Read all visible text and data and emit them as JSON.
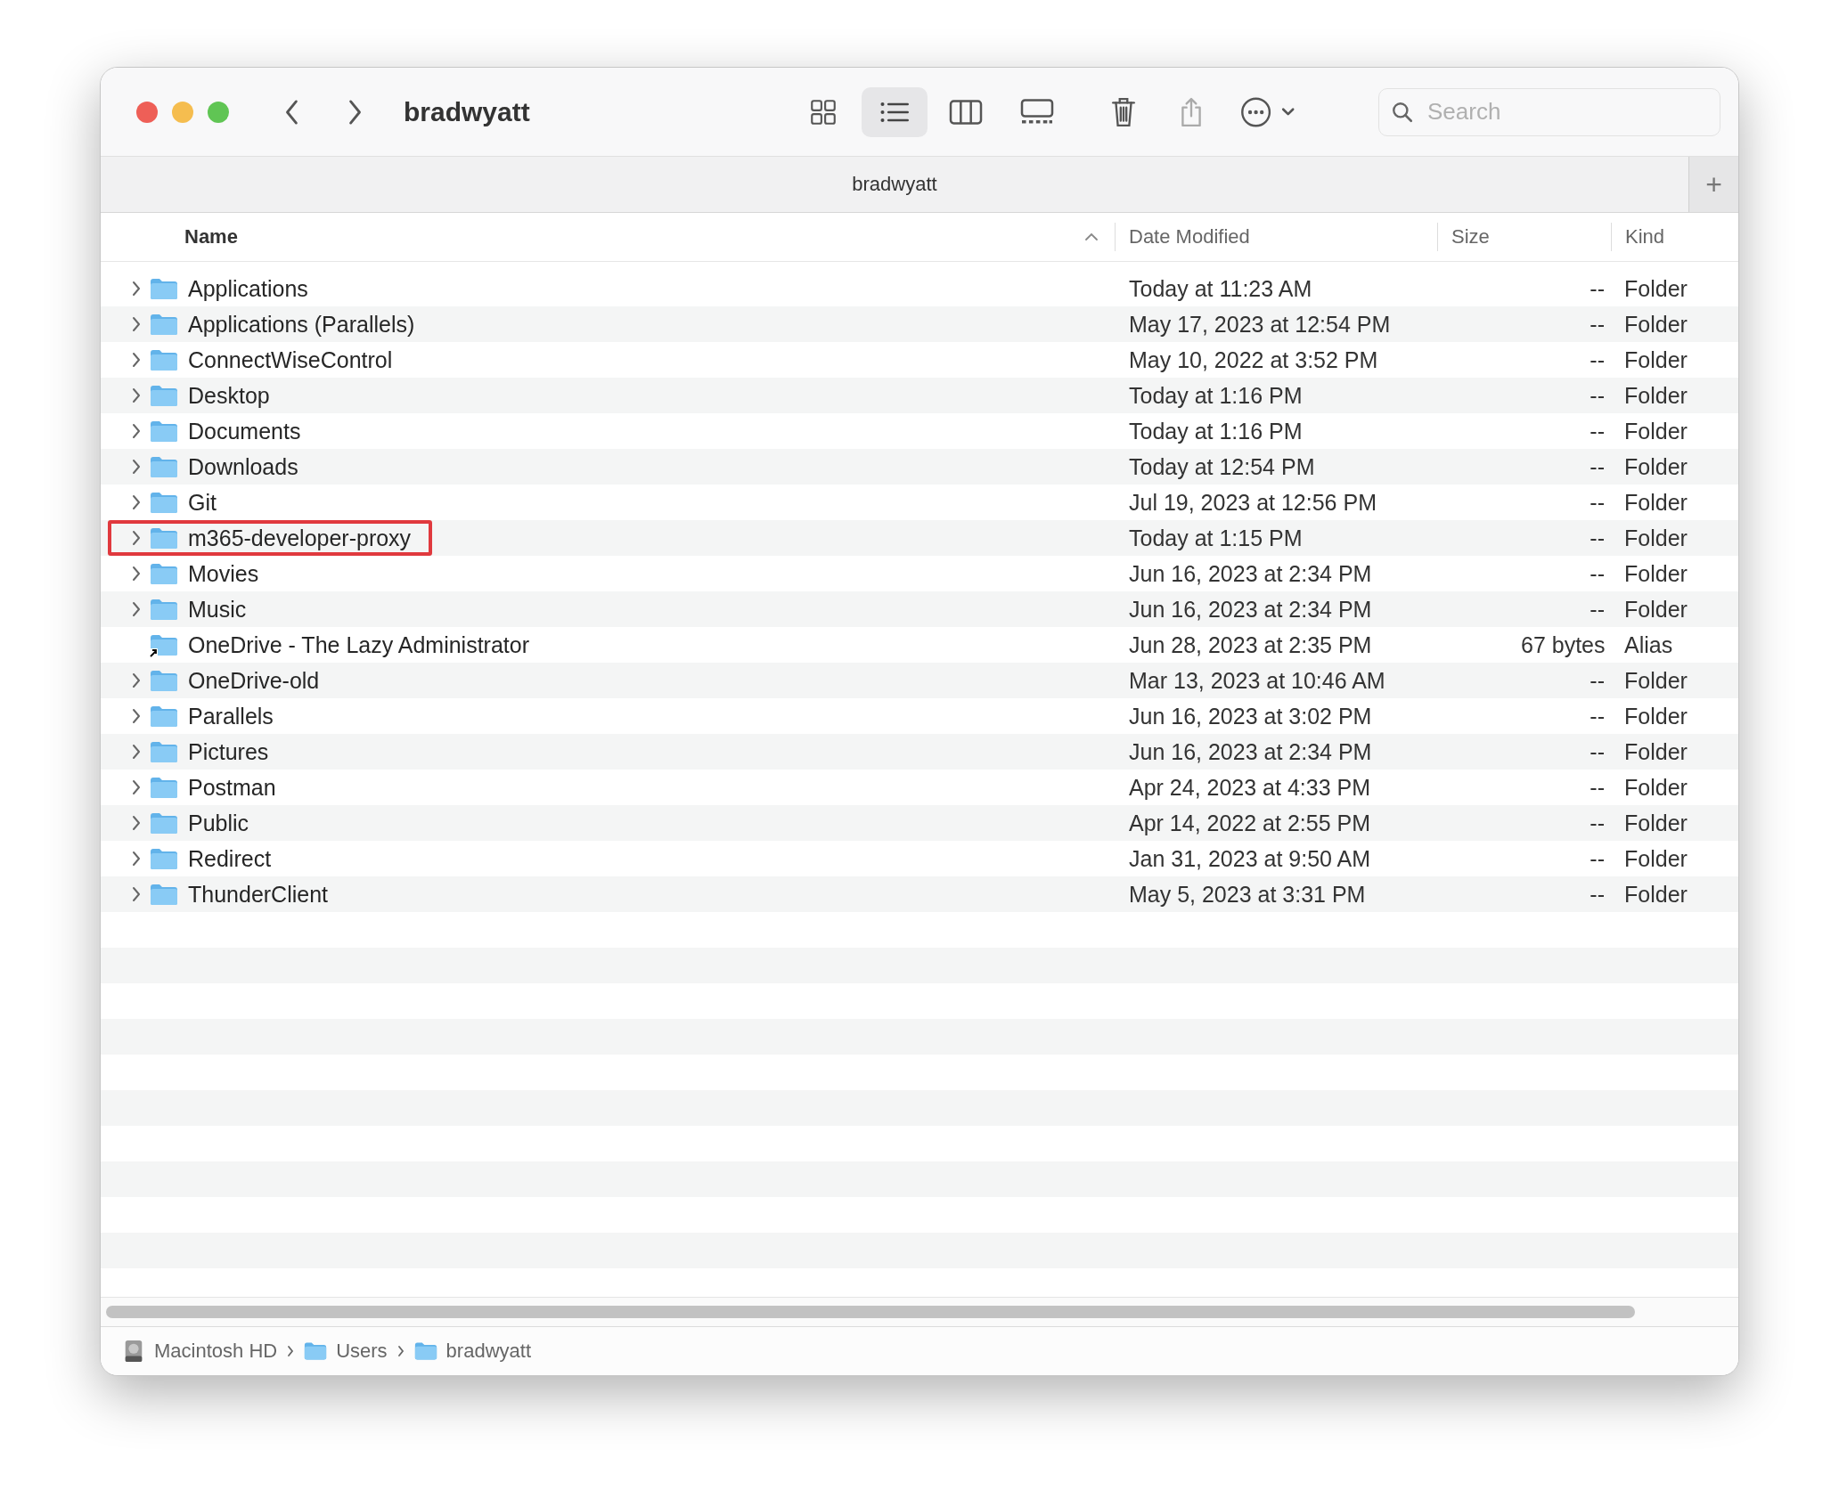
{
  "window": {
    "title": "bradwyatt"
  },
  "toolbar": {
    "view_buttons": [
      {
        "selected": false
      },
      {
        "selected": true
      },
      {
        "selected": false
      },
      {
        "selected": false
      }
    ],
    "search": {
      "placeholder": "Search"
    }
  },
  "tab_bar": {
    "tab": "bradwyatt",
    "new_tab_button": "+"
  },
  "table": {
    "columns": [
      "Name",
      "Date Modified",
      "Size",
      "Kind"
    ],
    "rows": [
      {
        "name": "Applications",
        "date": "Today at 11:23 AM",
        "size": "--",
        "kind_text": "Folder",
        "kind": "folder",
        "highlighted": false
      },
      {
        "name": "Applications (Parallels)",
        "date": "May 17, 2023 at 12:54 PM",
        "size": "--",
        "kind_text": "Folder",
        "kind": "folder",
        "highlighted": false
      },
      {
        "name": "ConnectWiseControl",
        "date": "May 10, 2022 at 3:52 PM",
        "size": "--",
        "kind_text": "Folder",
        "kind": "folder",
        "highlighted": false
      },
      {
        "name": "Desktop",
        "date": "Today at 1:16 PM",
        "size": "--",
        "kind_text": "Folder",
        "kind": "folder",
        "highlighted": false
      },
      {
        "name": "Documents",
        "date": "Today at 1:16 PM",
        "size": "--",
        "kind_text": "Folder",
        "kind": "folder",
        "highlighted": false
      },
      {
        "name": "Downloads",
        "date": "Today at 12:54 PM",
        "size": "--",
        "kind_text": "Folder",
        "kind": "folder",
        "highlighted": false
      },
      {
        "name": "Git",
        "date": "Jul 19, 2023 at 12:56 PM",
        "size": "--",
        "kind_text": "Folder",
        "kind": "folder",
        "highlighted": false
      },
      {
        "name": "m365-developer-proxy",
        "date": "Today at 1:15 PM",
        "size": "--",
        "kind_text": "Folder",
        "kind": "folder",
        "highlighted": true
      },
      {
        "name": "Movies",
        "date": "Jun 16, 2023 at 2:34 PM",
        "size": "--",
        "kind_text": "Folder",
        "kind": "folder",
        "highlighted": false
      },
      {
        "name": "Music",
        "date": "Jun 16, 2023 at 2:34 PM",
        "size": "--",
        "kind_text": "Folder",
        "kind": "folder",
        "highlighted": false
      },
      {
        "name": "OneDrive - The Lazy Administrator",
        "date": "Jun 28, 2023 at 2:35 PM",
        "size": "67 bytes",
        "kind_text": "Alias",
        "kind": "alias",
        "highlighted": false
      },
      {
        "name": "OneDrive-old",
        "date": "Mar 13, 2023 at 10:46 AM",
        "size": "--",
        "kind_text": "Folder",
        "kind": "folder",
        "highlighted": false
      },
      {
        "name": "Parallels",
        "date": "Jun 16, 2023 at 3:02 PM",
        "size": "--",
        "kind_text": "Folder",
        "kind": "folder",
        "highlighted": false
      },
      {
        "name": "Pictures",
        "date": "Jun 16, 2023 at 2:34 PM",
        "size": "--",
        "kind_text": "Folder",
        "kind": "folder",
        "highlighted": false
      },
      {
        "name": "Postman",
        "date": "Apr 24, 2023 at 4:33 PM",
        "size": "--",
        "kind_text": "Folder",
        "kind": "folder",
        "highlighted": false
      },
      {
        "name": "Public",
        "date": "Apr 14, 2022 at 2:55 PM",
        "size": "--",
        "kind_text": "Folder",
        "kind": "folder",
        "highlighted": false
      },
      {
        "name": "Redirect",
        "date": "Jan 31, 2023 at 9:50 AM",
        "size": "--",
        "kind_text": "Folder",
        "kind": "folder",
        "highlighted": false
      },
      {
        "name": "ThunderClient",
        "date": "May 5, 2023 at 3:31 PM",
        "size": "--",
        "kind_text": "Folder",
        "kind": "folder",
        "highlighted": false
      }
    ]
  },
  "path_bar": [
    {
      "label": "Macintosh HD",
      "kind": "disk"
    },
    {
      "label": "Users",
      "kind": "folder"
    },
    {
      "label": "bradwyatt",
      "kind": "folder"
    }
  ]
}
